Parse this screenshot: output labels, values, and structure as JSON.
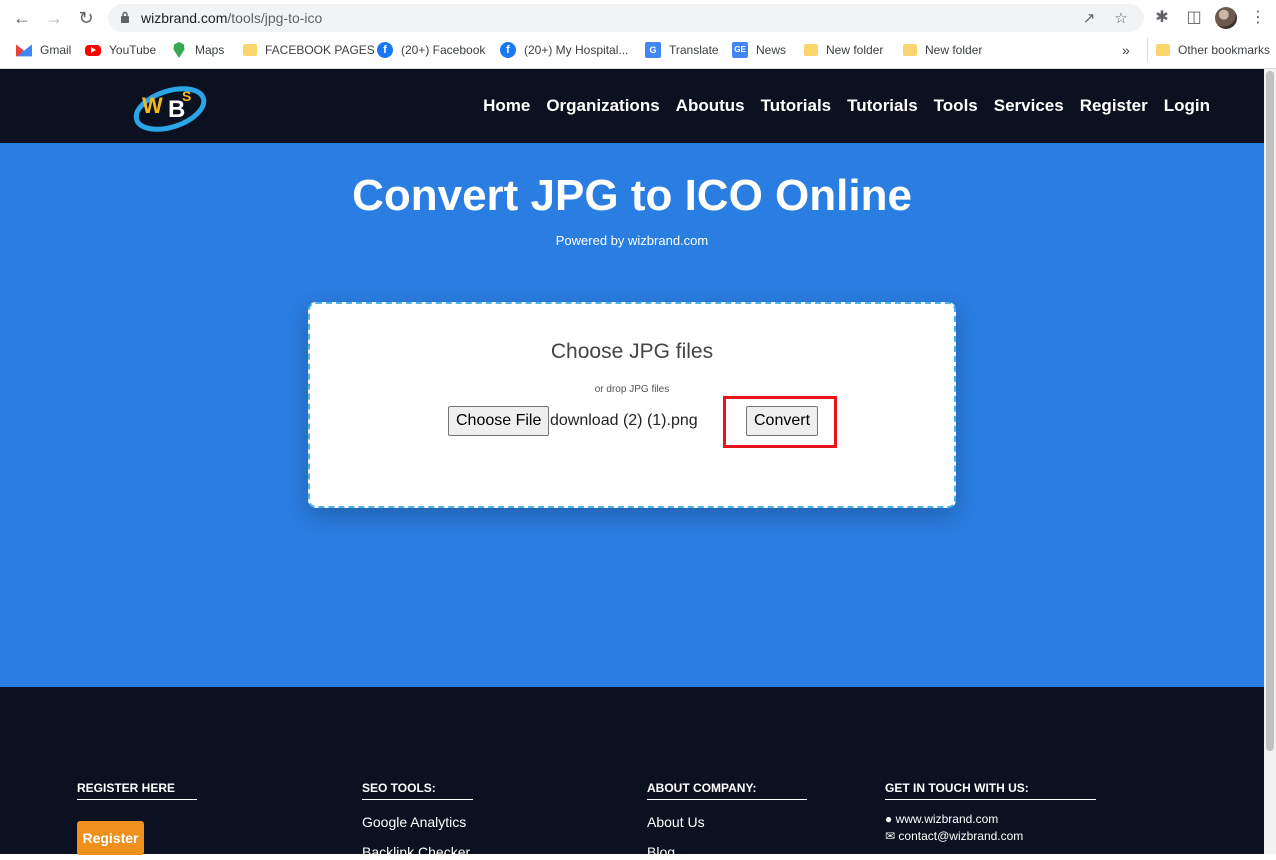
{
  "browser": {
    "url_host": "wizbrand.com",
    "url_path": "/tools/jpg-to-ico",
    "bookmarks": [
      {
        "label": "Gmail",
        "icon": "gmail-icon"
      },
      {
        "label": "YouTube",
        "icon": "youtube-icon"
      },
      {
        "label": "Maps",
        "icon": "maps-icon"
      },
      {
        "label": "FACEBOOK PAGES",
        "icon": "folder-icon"
      },
      {
        "label": "(20+) Facebook",
        "icon": "facebook-icon"
      },
      {
        "label": "(20+) My Hospital...",
        "icon": "facebook-icon"
      },
      {
        "label": "Translate",
        "icon": "translate-icon"
      },
      {
        "label": "News",
        "icon": "news-icon"
      },
      {
        "label": "New folder",
        "icon": "folder-icon"
      },
      {
        "label": "New folder",
        "icon": "folder-icon"
      }
    ],
    "overflow": "»",
    "other_bookmarks": "Other bookmarks"
  },
  "header": {
    "nav": [
      "Home",
      "Organizations",
      "Aboutus",
      "Tutorials",
      "Tutorials",
      "Tools",
      "Services",
      "Register",
      "Login"
    ]
  },
  "hero": {
    "title": "Convert JPG to ICO Online",
    "powered": "Powered by wizbrand.com",
    "upload": {
      "title": "Choose JPG files",
      "subtitle": "or drop JPG files",
      "choose_label": "Choose File",
      "filename": "download (2) (1).png",
      "convert_label": "Convert"
    }
  },
  "footer": {
    "register": {
      "heading": "REGISTER HERE",
      "button": "Register"
    },
    "seo": {
      "heading": "SEO TOOLS:",
      "links": [
        "Google Analytics",
        "Backlink Checker"
      ]
    },
    "about": {
      "heading": "ABOUT COMPANY:",
      "links": [
        "About Us",
        "Blog"
      ]
    },
    "contact": {
      "heading": "GET IN TOUCH WITH US:",
      "website": "www.wizbrand.com",
      "email": "contact@wizbrand.com"
    }
  },
  "colors": {
    "header_bg": "#0b1120",
    "hero_bg": "#2a7de1",
    "highlight": "#e8141c",
    "register_btn": "#f0901c"
  }
}
